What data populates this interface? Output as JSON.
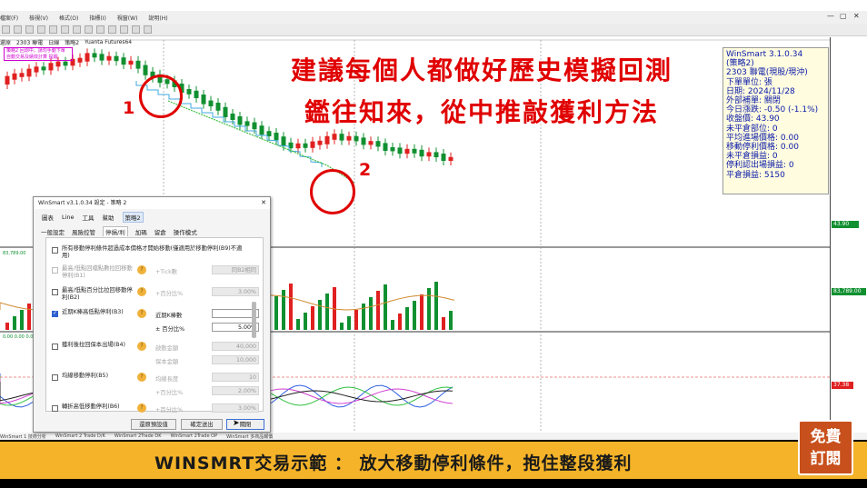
{
  "menu": [
    "檔案(F)",
    "檢視(V)",
    "格式(O)",
    "指標(I)",
    "視窗(W)",
    "說明(H)"
  ],
  "chart_toolbar": [
    "還原",
    "2303 聯電",
    "日線",
    "策略2",
    "Yuanta Futures64"
  ],
  "badge_lines": [
    "策略2 回測中，請勿手動下單",
    "自動交易及績效計算 提醒"
  ],
  "info_panel": [
    "WinSmart 3.1.0.34",
    "(策略2)",
    "2303 聯電(現股/現沖)",
    "下單單位: 張",
    "日期: 2024/11/28",
    "外部補單: 關閉",
    "今日漲跌: -0.50 (-1.1%)",
    "收盤價: 43.90",
    "未平倉部位: 0",
    "平均進場價格: 0.00",
    "移動停利價格: 0.00",
    "未平倉損益: 0",
    "停利認出場損益: 0",
    "平倉損益: 5150"
  ],
  "annotation": {
    "line1": "建議每個人都做好歷史模擬回測",
    "line2": "鑑往知來，從中推敲獲利方法",
    "mark1": "1",
    "mark2": "2"
  },
  "axis_tags": {
    "price": "43.90",
    "volume": "83,789.00",
    "indicator": "37.38",
    "vol_left": "83,789.00",
    "ind_left": "0.00 0.00 0.00"
  },
  "status_tabs": [
    "WinSmart 1 技術分析",
    "WinSmart 2 Trade D/K",
    "WinSmart 2Trade DK",
    "WinSmart 2Trade OP",
    "WinSmart 多商品報價"
  ],
  "dialog": {
    "title": "WinSmart v3.1.0.34 設定 - 策略 2",
    "close": "✕",
    "menu": [
      "圖表",
      "Line",
      "工具",
      "幫助",
      "策略2"
    ],
    "tabs": [
      "一般設定",
      "風險控管",
      "停損/利",
      "加碼",
      "留倉",
      "操作模式"
    ],
    "rows": [
      {
        "label": "所有移動停利條件超過成本價格才開始移動(僅適用於移動停利(B9)不適用)",
        "checked": false,
        "disabled": false
      },
      {
        "label": "最高/低點回檔點數拉回移動停利(B1)",
        "checked": false,
        "disabled": true,
        "param": "+Tick數",
        "value": "同B2相同"
      },
      {
        "label": "最高/低點百分比拉回移動停利(B2)",
        "checked": false,
        "disabled": false,
        "param": "+百分比%",
        "value": "3.00%"
      },
      {
        "label": "近期K棒高低點停利(B3)",
        "checked": true,
        "disabled": false,
        "param": "近期K棒數",
        "value": "3",
        "param2": "± 百分比%",
        "value2": "5.00%"
      },
      {
        "label": "獲利後拉回保本出場(B4)",
        "checked": false,
        "disabled": false,
        "param": "啟動金額",
        "value": "40,000",
        "param2": "保本金額",
        "value2": "10,000"
      },
      {
        "label": "均線移動停利(B5)",
        "checked": false,
        "disabled": false,
        "param": "均線長度",
        "value": "10",
        "param2": "+百分比%",
        "value2": "2.00%"
      },
      {
        "label": "轉折高低移動停利(B6)",
        "checked": false,
        "disabled": false,
        "param": "+百分比%",
        "value": "3.00%"
      }
    ],
    "help_glyph": "?",
    "buttons": {
      "reset": "還原預設值",
      "apply": "確定送出",
      "close": "關閉"
    }
  },
  "banner": {
    "text": "WINSMRT交易示範 ： 放大移動停利條件，抱住整段獲利",
    "subscribe_line1": "免費",
    "subscribe_line2": "訂閱"
  },
  "colors": {
    "candle_up": "#e02020",
    "candle_down": "#109030",
    "trail_stop": "#40a8e0",
    "trend_line": "#40c040",
    "accent_red": "#e00000",
    "banner": "#f4b329",
    "info_text": "#0a1aa8"
  }
}
